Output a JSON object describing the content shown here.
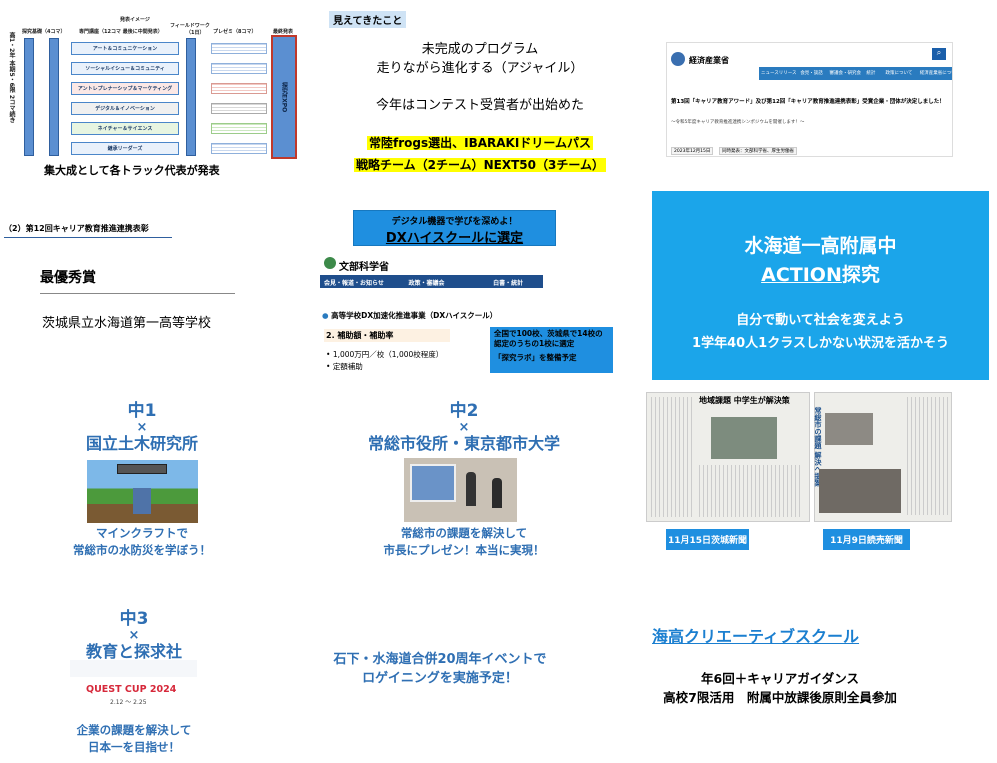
{
  "diagram": {
    "header_1": "探究基礎（4コマ）",
    "header_2": "専門講座（12コマ 最後に中間発表）",
    "header_3": "発表イメージ",
    "header_4": "フィールドワーク",
    "header_4b": "（1日）",
    "header_5": "プレゼミ（8コマ）",
    "header_6": "最終発表",
    "side_left": "高1・2年 本期5・6限 2コマ続き",
    "tracks": [
      "アート＆コミュニケーション",
      "ソーシャルイシュー＆コミュニティ",
      "アントレプレナーシップ＆マーケティング",
      "デジタル＆イノベーション",
      "ネイチャー＆サイエンス",
      "継承リーダーズ"
    ],
    "final_box": "探究EXPO",
    "caption": "集大成として各トラック代表が発表"
  },
  "findings": {
    "tag": "見えてきたこと",
    "line1": "未完成のプログラム",
    "line2": "走りながら進化する（アジャイル）",
    "line3": "今年はコンテスト受賞者が出始めた",
    "hl1": "常陸frogs選出、IBARAKIドリームパス",
    "hl2": "戦略チーム（2チーム）NEXT50（3チーム）"
  },
  "meti": {
    "org": "経済産業省",
    "nav": [
      "ニュースリリース",
      "会見・談話",
      "審議会・研究会",
      "統計",
      "政策について",
      "経済産業省について"
    ],
    "headline": "第13回「キャリア教育アワード」及び第12回「キャリア教育推進連携表彰」受賞企業・団体が決定しました！",
    "sub": "～令和5年度キャリア教育推進連携シンポジウムを開催します！～",
    "date": "2023年12月15日",
    "tag": "同時発表：文部科学省、厚生労働省"
  },
  "award": {
    "heading": "（2）第12回キャリア教育推進連携表彰",
    "top": "最優秀賞",
    "school": "茨城県立水海道第一高等学校"
  },
  "dx": {
    "box_line1": "デジタル機器で学びを深めよ！",
    "box_line2": "DXハイスクールに選定",
    "ministry": "文部科学省",
    "nav": [
      "会見・報道・お知らせ",
      "政策・審議会",
      "白書・統計"
    ],
    "title": "高等学校DX加速化推進事業（DXハイスクール）",
    "section": "2. 補助額・補助率",
    "bullet1": "1,000万円／校（1,000校程度）",
    "bullet2": "定額補助",
    "note1": "全国で100校、茨城県で14校の認定のうちの1校に選定",
    "note2": "「探究ラボ」を整備予定"
  },
  "action": {
    "title1": "水海道一高附属中",
    "title2a": "ACTION",
    "title2b": "探究",
    "line1": "自分で動いて社会を変えよう",
    "line2": "1学年40人1クラスしかない状況を活かそう"
  },
  "ms1": {
    "grade": "中1",
    "x": "×",
    "partner": "国立土木研究所",
    "desc1": "マインクラフトで",
    "desc2": "常総市の水防災を学ぼう！"
  },
  "ms2": {
    "grade": "中2",
    "x": "×",
    "partner": "常総市役所・東京都市大学",
    "desc1": "常総市の課題を解決して",
    "desc2": "市長にプレゼン！本当に実現！"
  },
  "ms3": {
    "grade": "中3",
    "x": "×",
    "partner": "教育と探求社",
    "cup": "QUEST CUP 2024",
    "cup_date": "2.12 ～ 2.25",
    "desc1": "企業の課題を解決して",
    "desc2": "日本一を目指せ！"
  },
  "event": {
    "line1": "石下・水海道合併20周年イベントで",
    "line2": "ロゲイニングを実施予定！"
  },
  "news": {
    "headline1": "地域課題 中学生が解決策",
    "headline2": "常総市の課題 解決へ提案",
    "label1": "11月15日茨城新聞",
    "label2": "11月9日読売新聞"
  },
  "creative": {
    "title": "海高クリエーティブスクール",
    "line1": "年6回＋キャリアガイダンス",
    "line2": "高校7限活用　附属中放課後原則全員参加"
  }
}
